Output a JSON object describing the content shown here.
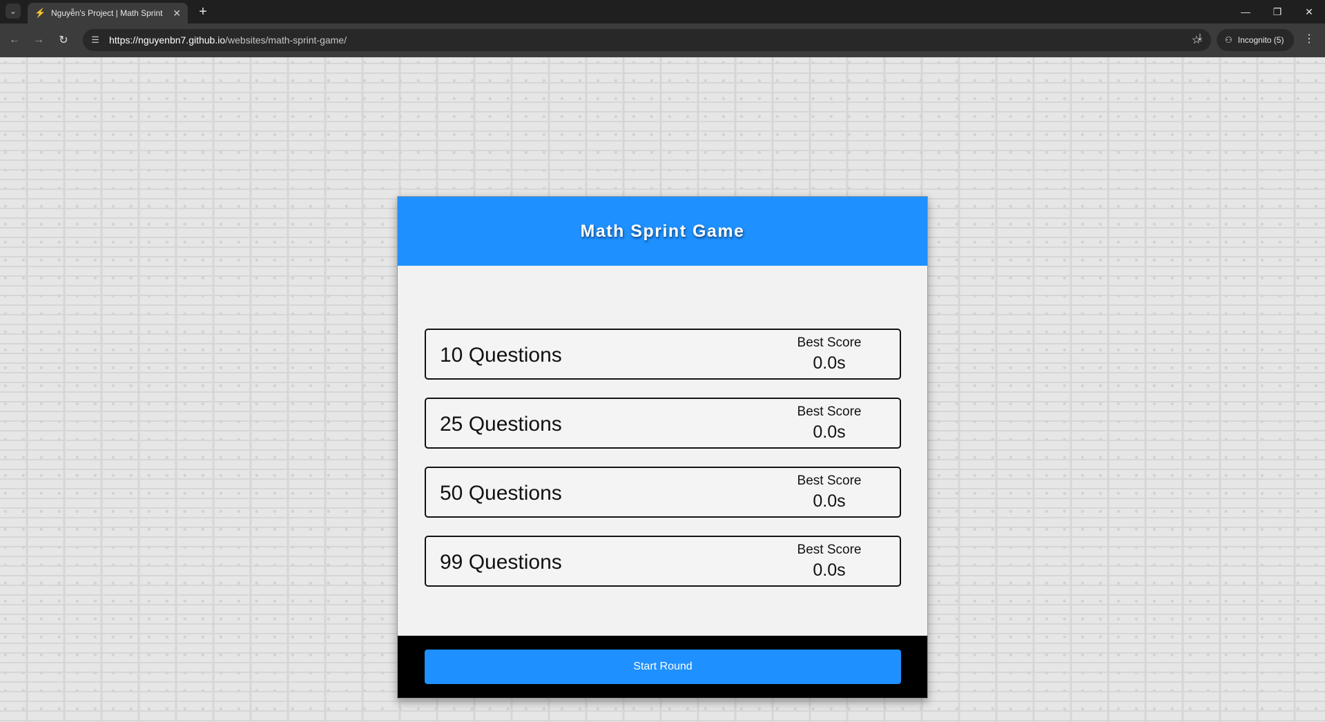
{
  "browser": {
    "tab_title": "Nguyễn's Project | Math Sprint",
    "url_host": "https://nguyenbn7.github.io",
    "url_path": "/websites/math-sprint-game/",
    "incognito_label": "Incognito (5)",
    "icons": {
      "tab_search": "chevron-down-icon",
      "favicon": "bolt-icon",
      "close": "close-icon",
      "new_tab": "plus-icon",
      "back": "arrow-left-icon",
      "forward": "arrow-right-icon",
      "reload": "reload-icon",
      "site_info": "tune-icon",
      "bookmark": "star-icon",
      "download": "download-icon",
      "incognito": "incognito-icon",
      "menu": "kebab-menu-icon",
      "minimize": "minimize-icon",
      "restore": "restore-icon",
      "window_close": "window-close-icon"
    }
  },
  "game": {
    "title": "Math Sprint Game",
    "choices": [
      {
        "label": "10 Questions",
        "best_score_label": "Best Score",
        "best_score": "0.0s"
      },
      {
        "label": "25 Questions",
        "best_score_label": "Best Score",
        "best_score": "0.0s"
      },
      {
        "label": "50 Questions",
        "best_score_label": "Best Score",
        "best_score": "0.0s"
      },
      {
        "label": "99 Questions",
        "best_score_label": "Best Score",
        "best_score": "0.0s"
      }
    ],
    "start_button": "Start Round"
  },
  "colors": {
    "accent": "#1e90ff",
    "footer": "#000000",
    "card_background": "#f2f2f2"
  }
}
